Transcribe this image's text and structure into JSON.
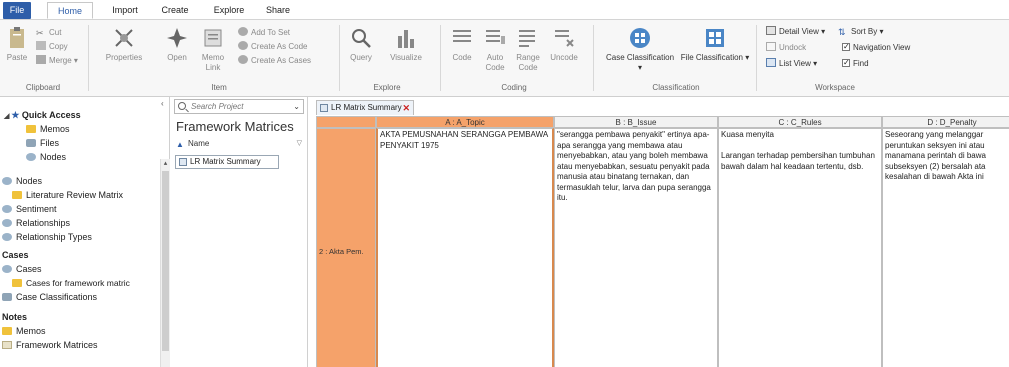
{
  "tabs": {
    "file": "File",
    "home": "Home",
    "import": "Import",
    "create": "Create",
    "explore": "Explore",
    "share": "Share"
  },
  "ribbon": {
    "clipboard": {
      "label": "Clipboard",
      "paste": "Paste",
      "cut": "Cut",
      "copy": "Copy",
      "merge": "Merge"
    },
    "item": {
      "label": "Item",
      "properties": "Properties",
      "open": "Open",
      "memo_link": "Memo Link",
      "add_to_set": "Add To Set",
      "create_as_code": "Create As Code",
      "create_as_cases": "Create As Cases"
    },
    "explore": {
      "label": "Explore",
      "query": "Query",
      "visualize": "Visualize"
    },
    "coding": {
      "label": "Coding",
      "code": "Code",
      "auto_code": "Auto Code",
      "range_code": "Range Code",
      "uncode": "Uncode"
    },
    "classification": {
      "label": "Classification",
      "case": "Case Classification",
      "file": "File Classification"
    },
    "workspace": {
      "label": "Workspace",
      "detail_view": "Detail View",
      "sort_by": "Sort By",
      "undock": "Undock",
      "navigation_view": "Navigation View",
      "list_view": "List View",
      "find": "Find"
    }
  },
  "nav": {
    "quick_access": "Quick Access",
    "quick_items": [
      "Memos",
      "Files",
      "Nodes"
    ],
    "nodes_head": "Nodes",
    "nodes_items": [
      "Literature Review Matrix",
      "Sentiment",
      "Relationships",
      "Relationship Types"
    ],
    "cases_head": "Cases",
    "cases_items": [
      "Cases",
      "Cases for framework matric",
      "Case Classifications"
    ],
    "notes_head": "Notes",
    "notes_items": [
      "Memos",
      "Framework Matrices"
    ]
  },
  "list": {
    "search_placeholder": "Search Project",
    "title": "Framework Matrices",
    "column_name": "Name",
    "items": [
      "LR Matrix Summary"
    ]
  },
  "detail": {
    "tab_label": "LR Matrix Summary",
    "columns": [
      "A : A_Topic",
      "B : B_Issue",
      "C : C_Rules",
      "D : D_Penalty"
    ],
    "row_label": "2 : Akta Pem.",
    "cells": [
      "AKTA PEMUSNAHAN SERANGGA PEMBAWA PENYAKIT 1975",
      "\"serangga pembawa penyakit\" ertinya apa-apa serangga yang membawa atau menyebabkan, atau yang boleh membawa atau menyebabkan, sesuatu penyakit pada manusia atau binatang ternakan, dan termasuklah telur, larva dan pupa serangga itu.",
      "Kuasa menyita\n\nLarangan terhadap pembersihan tumbuhan bawah dalam hal keadaan tertentu, dsb.",
      "Seseorang yang melanggar peruntukan seksyen ini atau manamana perintah di bawa subseksyen (2) bersalah ata kesalahan di bawah Akta ini"
    ]
  },
  "colors": {
    "file_tab": "#2e5ea9",
    "selected": "#f5a26a"
  }
}
